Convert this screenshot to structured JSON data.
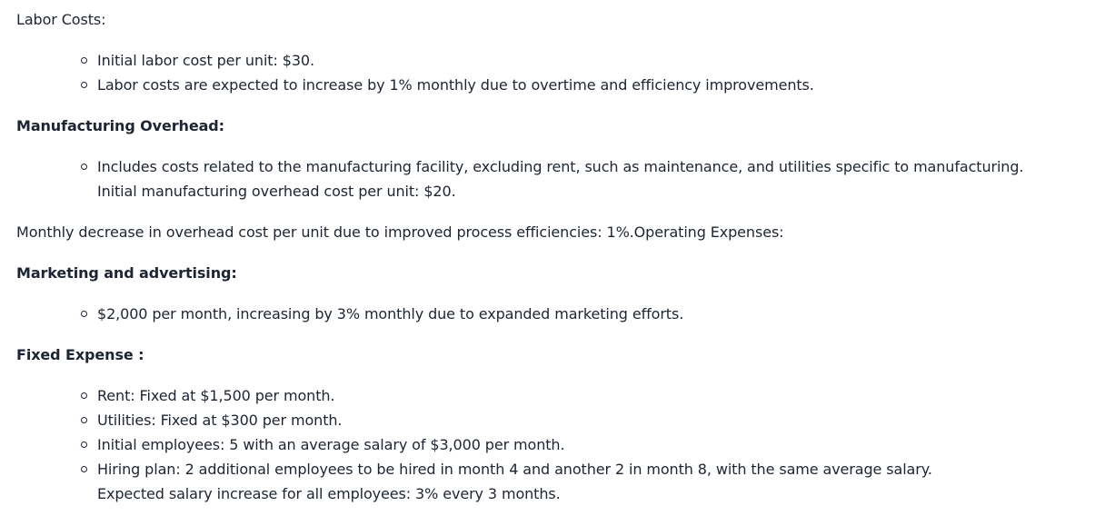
{
  "labor": {
    "heading": "Labor Costs:",
    "items": [
      "Initial labor cost per unit: $30.",
      "Labor costs are expected to increase by 1% monthly due to overtime and efficiency improvements."
    ]
  },
  "overhead": {
    "heading": "Manufacturing Overhead:",
    "item_line1": "Includes costs related to the manufacturing facility, excluding rent, such as maintenance, and utilities specific to manufacturing.",
    "item_line2": "Initial manufacturing overhead cost per unit: $20.",
    "note": "Monthly decrease in overhead cost per unit due to improved process efficiencies: 1%.Operating Expenses:"
  },
  "marketing": {
    "heading": "Marketing and advertising:",
    "items": [
      "$2,000 per month, increasing by 3% monthly due to expanded marketing efforts."
    ]
  },
  "fixed": {
    "heading": "Fixed Expense :",
    "items": [
      "Rent: Fixed at $1,500 per month.",
      "Utilities: Fixed at $300 per month.",
      "Initial employees: 5 with an average salary of $3,000 per month."
    ],
    "hiring_line1": "Hiring plan: 2 additional employees to be hired in month 4 and another 2 in month 8, with the same average salary.",
    "hiring_line2": "Expected salary increase for all employees: 3% every 3 months."
  }
}
